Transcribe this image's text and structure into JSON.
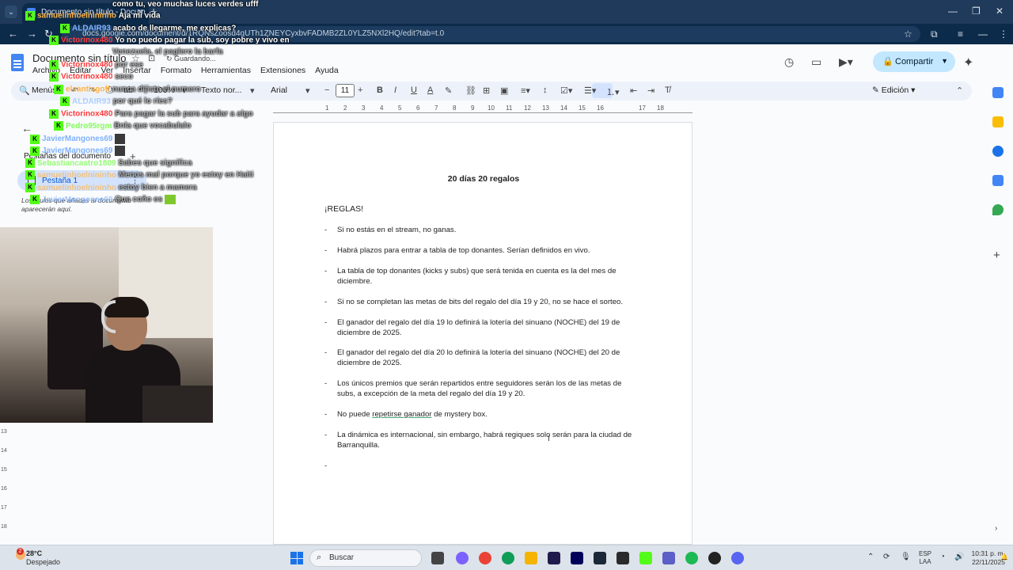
{
  "browser": {
    "tab_title": "Documento sin título - Docum",
    "url": "docs.google.com/document/d/1RQNsZoosd4qUTh1ZNEYCyxbvFADMB2ZL0YLZ5NXl2HQ/edit?tab=t.0"
  },
  "docs": {
    "title": "Documento sin título",
    "saving_status": "Guardando...",
    "menu": [
      "Archivo",
      "Editar",
      "Ver",
      "Insertar",
      "Formato",
      "Herramientas",
      "Extensiones",
      "Ayuda"
    ],
    "share_label": "Compartir",
    "toolbar": {
      "search_label": "Menús",
      "zoom": "100%",
      "style": "Texto nor...",
      "font": "Arial",
      "font_size": "11",
      "mode": "Edición"
    },
    "ruler_numbers": [
      "1",
      "2",
      "3",
      "4",
      "5",
      "6",
      "7",
      "8",
      "9",
      "10",
      "11",
      "12",
      "13",
      "14",
      "15",
      "16",
      "17",
      "18"
    ],
    "vruler_numbers": [
      "13",
      "14",
      "15",
      "16",
      "17",
      "18"
    ]
  },
  "left_panel": {
    "tabs_title": "Pestañas del documento",
    "tab_label": "Pestaña 1",
    "note": "Los títulos que añadas al documento aparecerán aquí."
  },
  "document": {
    "heading": "20 días 20 regalos",
    "rules_label": "¡REGLAS!",
    "rules": [
      "Si no estás en el stream, no ganas.",
      "Habrá plazos para entrar a tabla de top donantes. Serían definidos en vivo.",
      "La tabla de top donantes (kicks y subs) que será tenida en cuenta es la del mes de diciembre.",
      "Si no se completan las metas de bits del regalo del día 19 y 20, no se hace el sorteo.",
      "El ganador del regalo del día 19 lo definirá la lotería del sinuano (NOCHE) del 19 de diciembre de 2025.",
      "El ganador del regalo del día 20 lo definirá la lotería del sinuano (NOCHE) del 20 de diciembre de 2025.",
      "Los únicos premios que serán repartidos entre seguidores serán los de las metas de subs, a excepción de la meta del regalo del día 19 y 20."
    ],
    "rule8_before": "No puede ",
    "rule8_underlined": "repetirse ganador",
    "rule8_after": " de mystery box.",
    "rule9": "La dinámica es internacional, sin embargo, habrá regiques solo serán para la ciudad de Barranquilla.",
    "rule10": ""
  },
  "chat": [
    {
      "user": "",
      "msg": "como tu, veo muchas luces verdes ufff",
      "user_color": "#ffffff"
    },
    {
      "user": "samuelinhoelnininho",
      "msg": "Aja mi vida",
      "user_color": "#ffb347"
    },
    {
      "user": "ALDAIR93",
      "msg": "acabo de llegarme, me explicas?",
      "user_color": "#7fb2ff"
    },
    {
      "user": "Victorinox480",
      "msg": "Yo no puedo pagar la sub, soy pobre y vivo en",
      "user_color": "#ff3b3b"
    },
    {
      "user": "",
      "msg": "Venezuela, el paglero la barfa",
      "user_color": "#ffffff"
    },
    {
      "user": "Victorinox480",
      "msg": "por ese",
      "user_color": "#ff3b3b"
    },
    {
      "user": "Victorinox480",
      "msg": "seco",
      "user_color": "#ff3b3b"
    },
    {
      "user": "elsantiagoff",
      "msg": "nunca dijiste el numero",
      "user_color": "#ffb347"
    },
    {
      "user": "ALDAIR93",
      "msg": "por qué lo ríes?",
      "user_color": "#7fb2ff"
    },
    {
      "user": "Victorinox480",
      "msg": "Para pagar la sub para ayudar a algo",
      "user_color": "#ff3b3b"
    },
    {
      "user": "Pedro95rgm",
      "msg": "Bnla que vocabulalo",
      "user_color": "#53fc18"
    },
    {
      "user": "JavierMangones69",
      "msg": "",
      "user_color": "#7fb2ff"
    },
    {
      "user": "JavierMangones69",
      "msg": "",
      "user_color": "#7fb2ff"
    },
    {
      "user": "Sebastiancastro1809",
      "msg": "Sabes que significa",
      "user_color": "#53fc18"
    },
    {
      "user": "samuelinhoelnininho",
      "msg": "Menos mal porque yo estoy en Haiti",
      "user_color": "#ffb347"
    },
    {
      "user": "samuelinhoelnininho",
      "msg": "estoy bien a mamera",
      "user_color": "#ffb347"
    },
    {
      "user": "JavierMangones69",
      "msg": "Que coño es",
      "user_color": "#7fb2ff"
    }
  ],
  "taskbar": {
    "weather_badge": "2",
    "temperature": "28°C",
    "weather": "Despejado",
    "search_label": "Buscar",
    "lang_line1": "ESP",
    "lang_line2": "LAA",
    "time": "10:31 p. m.",
    "date": "22/11/2025"
  },
  "colors": {
    "kick_green": "#53fc18",
    "docs_blue": "#4285f4",
    "share_bg": "#c2e7ff"
  }
}
